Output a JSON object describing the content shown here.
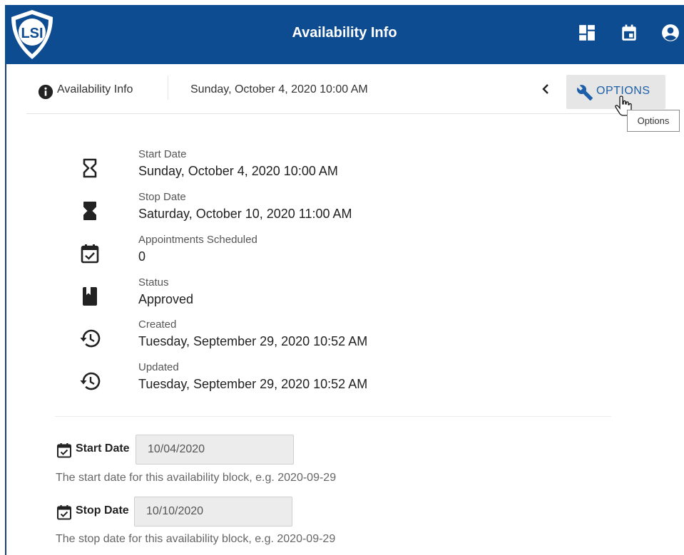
{
  "app": {
    "title": "Availability Info",
    "logo_text": "LSI",
    "colors": {
      "appbar": "#0e4c92",
      "link": "#1d5fa8"
    },
    "icons": [
      "dashboard-icon",
      "calendar-icon",
      "account-circle-icon"
    ]
  },
  "toolbar": {
    "info_label": "Availability Info",
    "date": "Sunday, October 4, 2020 10:00 AM",
    "options_label": "OPTIONS",
    "tooltip": "Options"
  },
  "details": [
    {
      "label": "Start Date",
      "value": "Sunday, October 4, 2020 10:00 AM",
      "icon": "hourglass-empty-icon"
    },
    {
      "label": "Stop Date",
      "value": "Saturday, October 10, 2020 11:00 AM",
      "icon": "hourglass-full-icon"
    },
    {
      "label": "Appointments Scheduled",
      "value": "0",
      "icon": "event-available-icon"
    },
    {
      "label": "Status",
      "value": "Approved",
      "icon": "book-icon"
    },
    {
      "label": "Created",
      "value": "Tuesday, September 29, 2020 10:52 AM",
      "icon": "history-icon"
    },
    {
      "label": "Updated",
      "value": "Tuesday, September 29, 2020 10:52 AM",
      "icon": "history-icon"
    }
  ],
  "form": {
    "start": {
      "label": "Start Date",
      "value": "10/04/2020",
      "help": "The start date for this availability block, e.g. 2020-09-29"
    },
    "stop": {
      "label": "Stop Date",
      "value": "10/10/2020",
      "help": "The stop date for this availability block, e.g. 2020-09-29"
    }
  }
}
